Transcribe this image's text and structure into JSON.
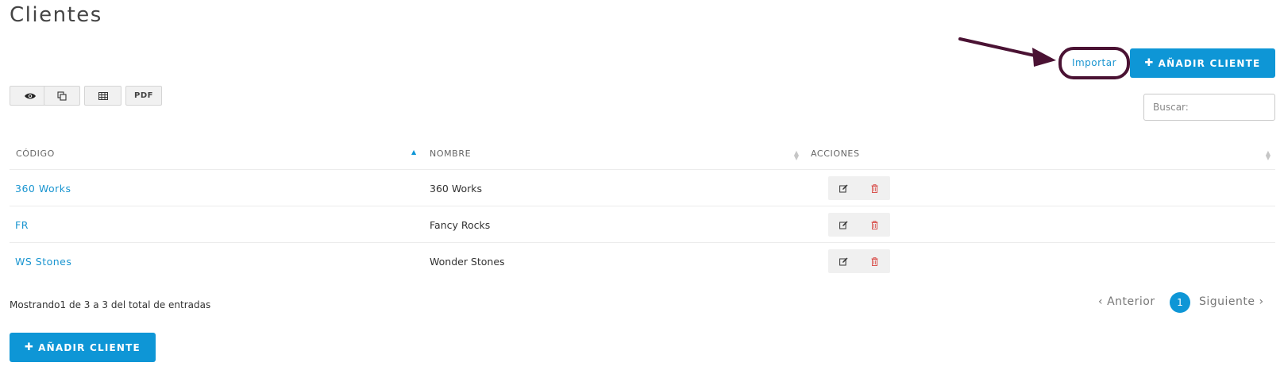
{
  "page": {
    "title": "Clientes"
  },
  "toolbar": {
    "import_label": "Importar",
    "add_label": "AÑADIR CLIENTE",
    "export_buttons": [
      {
        "label": "",
        "icon": "eye-icon"
      },
      {
        "label": "",
        "icon": "copy-icon"
      },
      {
        "label": "",
        "icon": "table-icon"
      },
      {
        "label": "PDF",
        "icon": ""
      }
    ]
  },
  "search": {
    "placeholder": "Buscar:",
    "value": ""
  },
  "table": {
    "columns": [
      "CÓDIGO",
      "NOMBRE",
      "ACCIONES"
    ],
    "rows": [
      {
        "code": "360 Works",
        "name": "360 Works"
      },
      {
        "code": "FR",
        "name": "Fancy Rocks"
      },
      {
        "code": "WS Stones",
        "name": "Wonder Stones"
      }
    ]
  },
  "footer": {
    "info": "Mostrando1 de 3 a 3 del total de entradas",
    "prev_label": "Anterior",
    "next_label": "Siguiente",
    "current_page": "1",
    "add_label": "AÑADIR CLIENTE"
  },
  "colors": {
    "primary": "#0e96d6",
    "link": "#1a95d0",
    "annotation": "#4a1233",
    "delete_icon": "#d9534f"
  }
}
